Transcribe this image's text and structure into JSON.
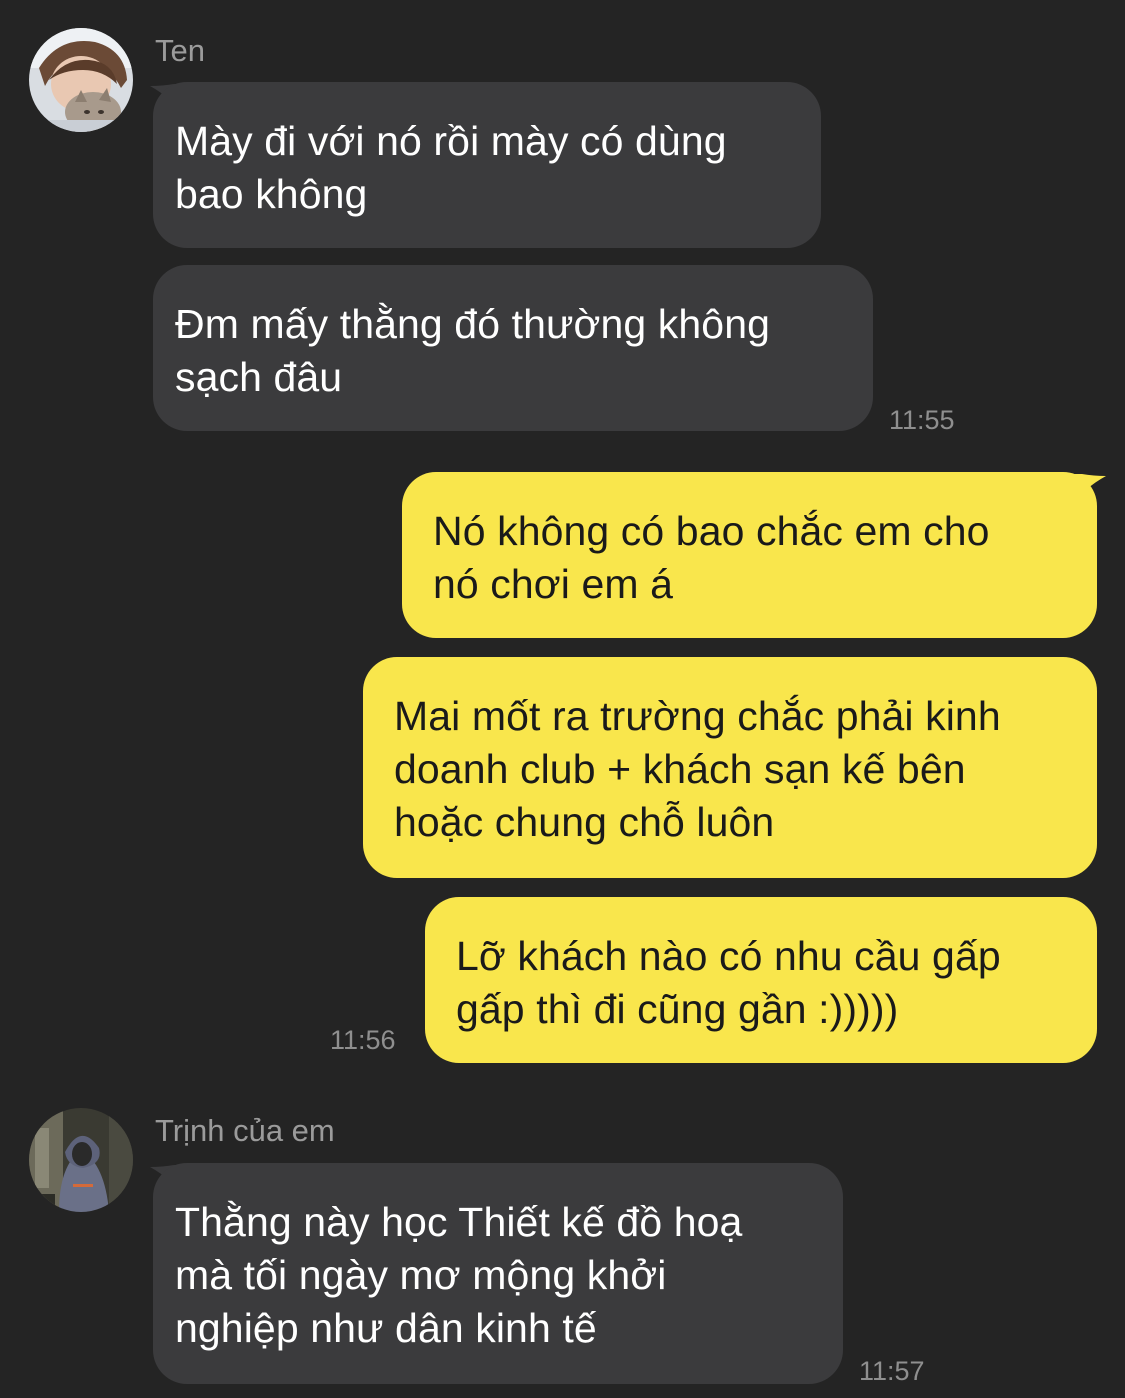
{
  "chat": {
    "group1": {
      "sender": "Ten",
      "messages": [
        "Mày đi với nó rồi mày có dùng\nbao không",
        "Đm mấy thằng đó thường không\nsạch đâu"
      ],
      "time": "11:55"
    },
    "group2": {
      "messages": [
        "Nó không có bao chắc em cho\nnó chơi em á",
        "Mai mốt ra trường chắc phải kinh\ndoanh club + khách sạn kế bên\nhoặc chung chỗ luôn",
        "Lỡ khách nào có nhu cầu gấp\ngấp thì đi cũng gần :)))))"
      ],
      "time": "11:56"
    },
    "group3": {
      "sender": "Trịnh của em",
      "messages": [
        "Thằng này học Thiết kế đồ hoạ\nmà tối ngày mơ mộng khởi\nnghiệp như dân kinh tế"
      ],
      "time": "11:57"
    }
  },
  "colors": {
    "background": "#242424",
    "incoming_bubble": "#3b3b3d",
    "outgoing_bubble": "#f9e64c",
    "timestamp": "#8f8f8f"
  }
}
